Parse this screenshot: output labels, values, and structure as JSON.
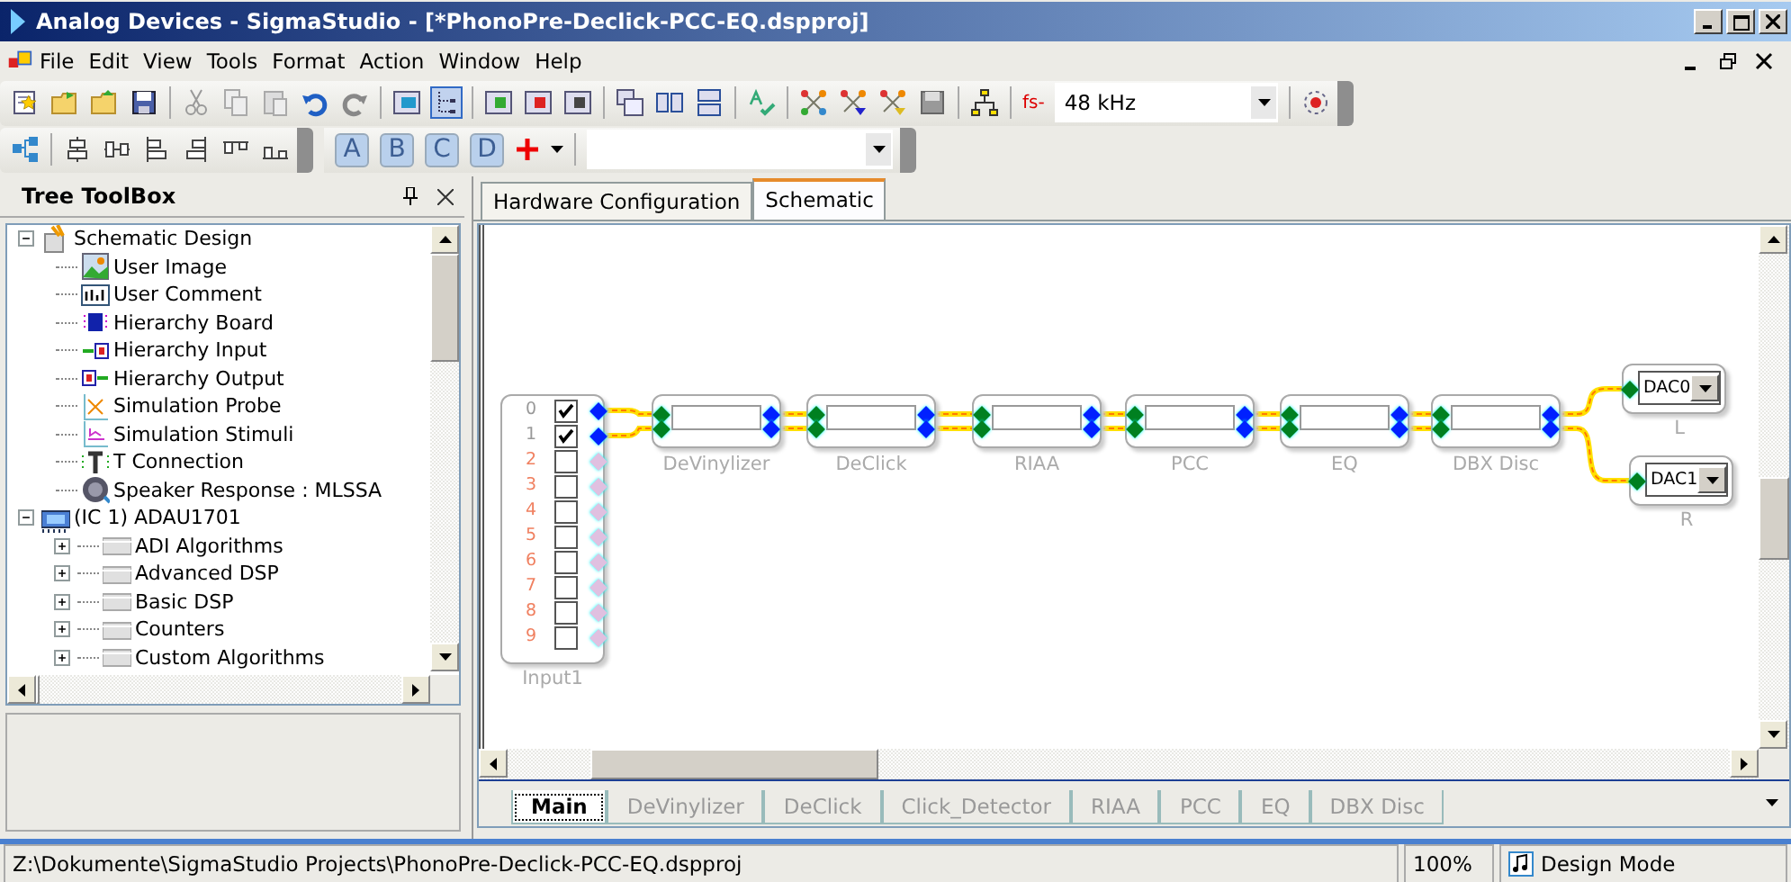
{
  "window": {
    "title": "Analog Devices - SigmaStudio - [*PhonoPre-Declick-PCC-EQ.dspproj]"
  },
  "menu": [
    "File",
    "Edit",
    "View",
    "Tools",
    "Format",
    "Action",
    "Window",
    "Help"
  ],
  "sample_rate": {
    "prefix": "fs-",
    "value": "48 kHz"
  },
  "letter_buttons": [
    "A",
    "B",
    "C",
    "D"
  ],
  "toolbox": {
    "title": "Tree ToolBox",
    "tree": [
      {
        "label": "Schematic Design",
        "expanded": true,
        "children": [
          {
            "label": "User Image"
          },
          {
            "label": "User Comment"
          },
          {
            "label": "Hierarchy Board"
          },
          {
            "label": "Hierarchy Input"
          },
          {
            "label": "Hierarchy Output"
          },
          {
            "label": "Simulation Probe"
          },
          {
            "label": "Simulation Stimuli"
          },
          {
            "label": "T Connection"
          },
          {
            "label": "Speaker Response : MLSSA"
          }
        ]
      },
      {
        "label": "(IC 1) ADAU1701",
        "expanded": true,
        "children": [
          {
            "label": "ADI Algorithms",
            "expanded": false
          },
          {
            "label": "Advanced DSP",
            "expanded": false
          },
          {
            "label": "Basic DSP",
            "expanded": false
          },
          {
            "label": "Counters",
            "expanded": false
          },
          {
            "label": "Custom Algorithms",
            "expanded": false
          }
        ]
      }
    ]
  },
  "tabs": [
    {
      "label": "Hardware Configuration",
      "selected": false
    },
    {
      "label": "Schematic",
      "selected": true
    }
  ],
  "schematic": {
    "input": {
      "label": "Input1",
      "channels": [
        {
          "number": "0",
          "checked": true
        },
        {
          "number": "1",
          "checked": true
        },
        {
          "number": "2",
          "checked": false
        },
        {
          "number": "3",
          "checked": false
        },
        {
          "number": "4",
          "checked": false
        },
        {
          "number": "5",
          "checked": false
        },
        {
          "number": "6",
          "checked": false
        },
        {
          "number": "7",
          "checked": false
        },
        {
          "number": "8",
          "checked": false
        },
        {
          "number": "9",
          "checked": false
        }
      ]
    },
    "blocks": [
      {
        "label": "DeVinylizer"
      },
      {
        "label": "DeClick"
      },
      {
        "label": "RIAA"
      },
      {
        "label": "PCC"
      },
      {
        "label": "EQ"
      },
      {
        "label": "DBX Disc"
      }
    ],
    "outputs": [
      {
        "value": "DAC0",
        "label": "L"
      },
      {
        "value": "DAC1",
        "label": "R"
      }
    ]
  },
  "sheet_tabs": [
    {
      "label": "Main",
      "selected": true
    },
    {
      "label": "DeVinylizer",
      "selected": false
    },
    {
      "label": "DeClick",
      "selected": false
    },
    {
      "label": "Click_Detector",
      "selected": false
    },
    {
      "label": "RIAA",
      "selected": false
    },
    {
      "label": "PCC",
      "selected": false
    },
    {
      "label": "EQ",
      "selected": false
    },
    {
      "label": "DBX Disc",
      "selected": false
    }
  ],
  "status_bar": {
    "path": "Z:\\Dokumente\\SigmaStudio Projects\\PhonoPre-Declick-PCC-EQ.dspproj",
    "zoom": "100%",
    "mode": "Design Mode"
  }
}
